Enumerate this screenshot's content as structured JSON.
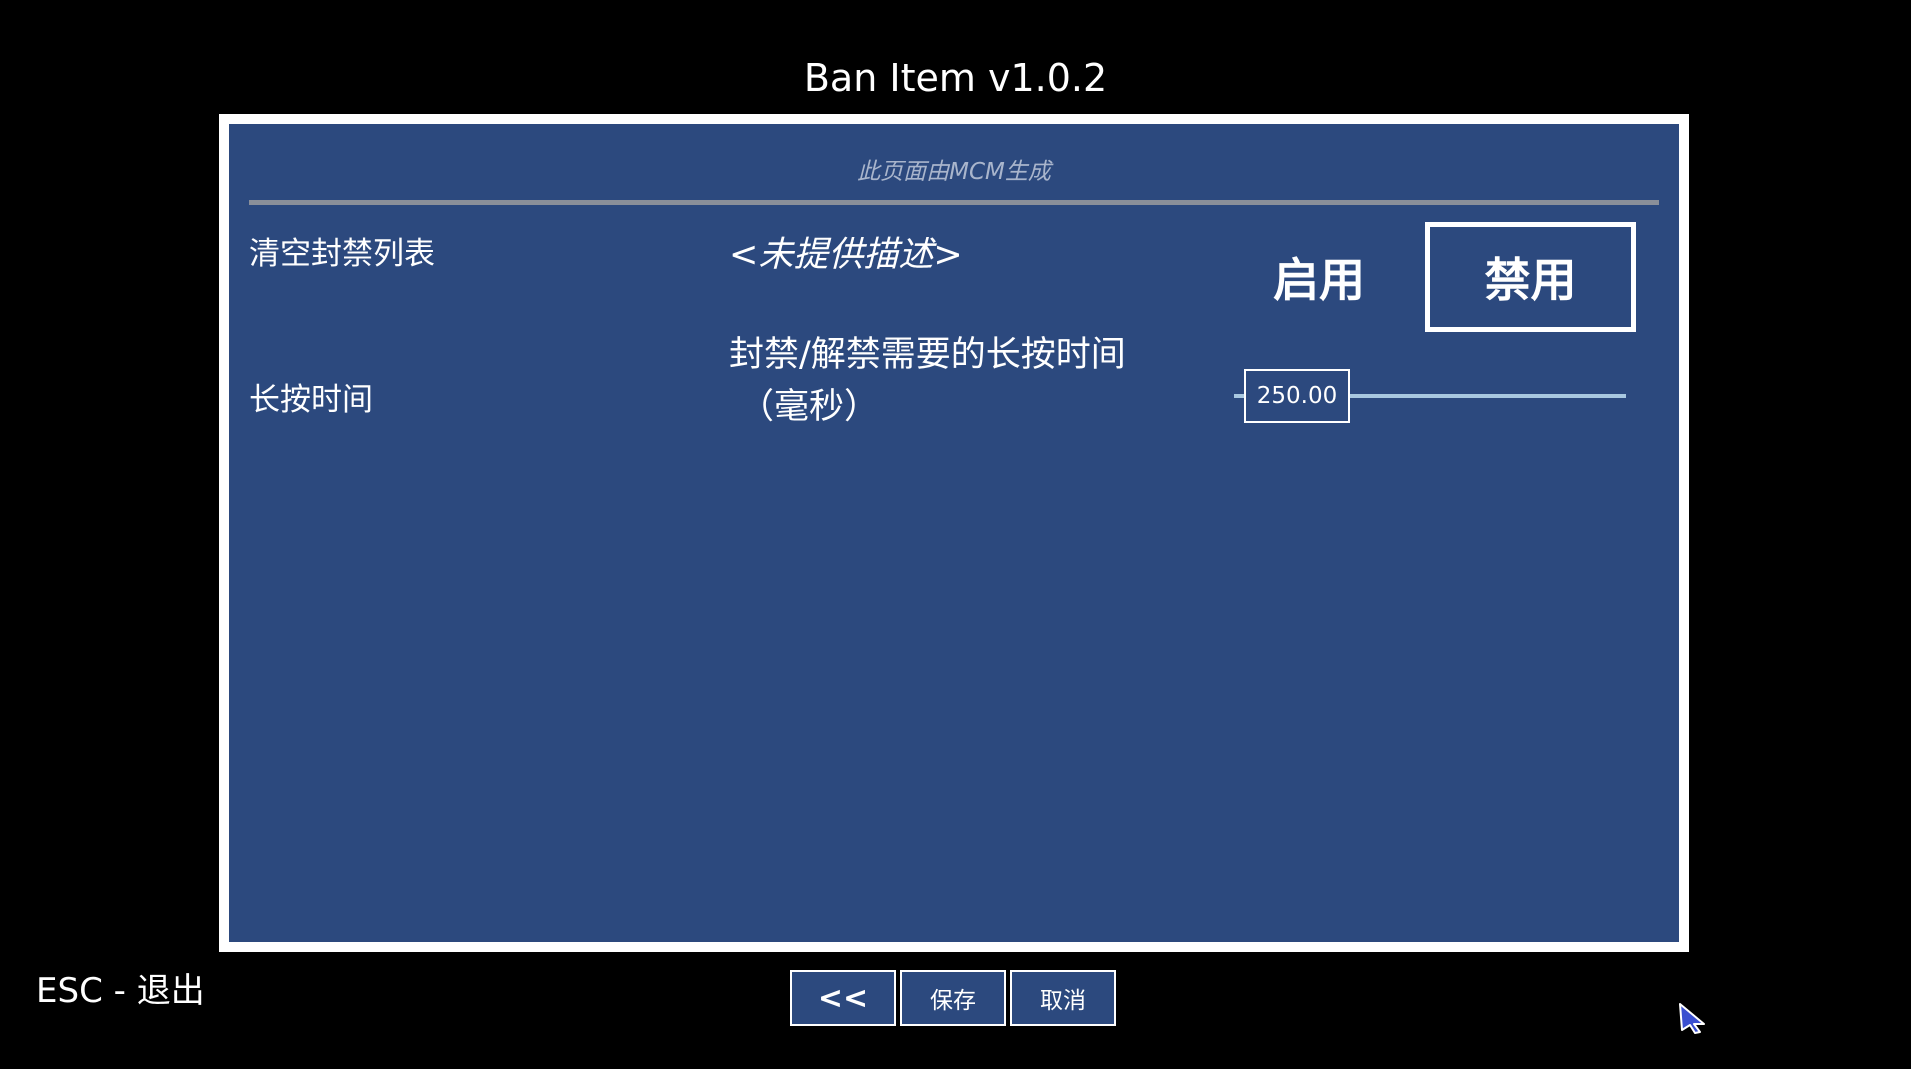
{
  "window": {
    "title": "Ban Item  v1.0.2"
  },
  "panel": {
    "subtitle": "此页面由MCM生成",
    "settings": [
      {
        "label": "清空封禁列表",
        "description": "<未提供描述>",
        "control": "toggle",
        "options": [
          "启用",
          "禁用"
        ],
        "selected": "禁用"
      },
      {
        "label": "长按时间",
        "description_line1": "封禁/解禁需要的长按时间",
        "description_line2": "（毫秒）",
        "control": "slider",
        "value": "250.00"
      }
    ]
  },
  "footer": {
    "esc_hint": "ESC - 退出",
    "back_label": "<<",
    "save_label": "保存",
    "cancel_label": "取消"
  },
  "colors": {
    "panel_bg": "#2c497e",
    "panel_border": "#ffffff",
    "screen_bg": "#000000",
    "slider_track": "#a8c8e0",
    "divider": "#8a8f99",
    "subtitle_text": "#a9b5cc"
  },
  "icons": {
    "cursor": "mouse-pointer-icon"
  }
}
